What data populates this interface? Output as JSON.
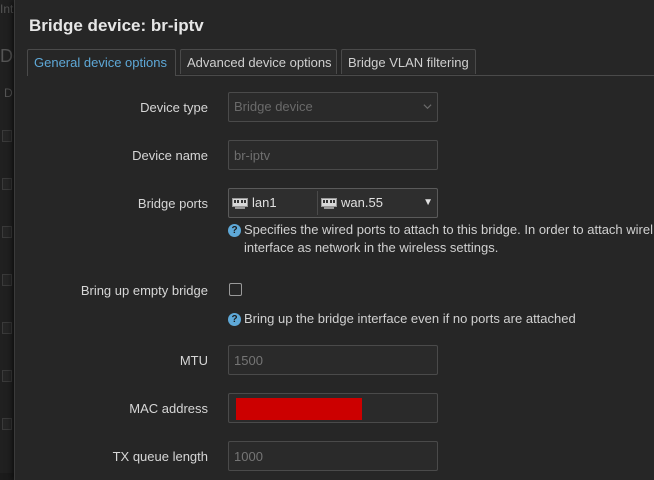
{
  "background": {
    "fragments": [
      "Int",
      "De",
      "D"
    ]
  },
  "modal": {
    "title": "Bridge device: br-iptv",
    "tabs": [
      {
        "label": "General device options",
        "active": true
      },
      {
        "label": "Advanced device options",
        "active": false
      },
      {
        "label": "Bridge VLAN filtering",
        "active": false
      }
    ]
  },
  "form": {
    "device_type": {
      "label": "Device type",
      "value": "Bridge device"
    },
    "device_name": {
      "label": "Device name",
      "value": "br-iptv"
    },
    "bridge_ports": {
      "label": "Bridge ports",
      "ports": [
        {
          "name": "lan1",
          "icon": "ethernet-port-icon"
        },
        {
          "name": "wan.55",
          "icon": "ethernet-port-icon"
        }
      ],
      "help": "Specifies the wired ports to attach to this bridge. In order to attach wirel",
      "help_line2": "interface as network in the wireless settings."
    },
    "empty_bridge": {
      "label": "Bring up empty bridge",
      "checked": false,
      "help": "Bring up the bridge interface even if no ports are attached"
    },
    "mtu": {
      "label": "MTU",
      "placeholder": "1500"
    },
    "mac": {
      "label": "MAC address",
      "value": "",
      "redacted": true
    },
    "txqueue": {
      "label": "TX queue length",
      "placeholder": "1000"
    }
  },
  "colors": {
    "accent": "#5ea8d7",
    "redaction": "#cc0000",
    "background": "#262626"
  }
}
